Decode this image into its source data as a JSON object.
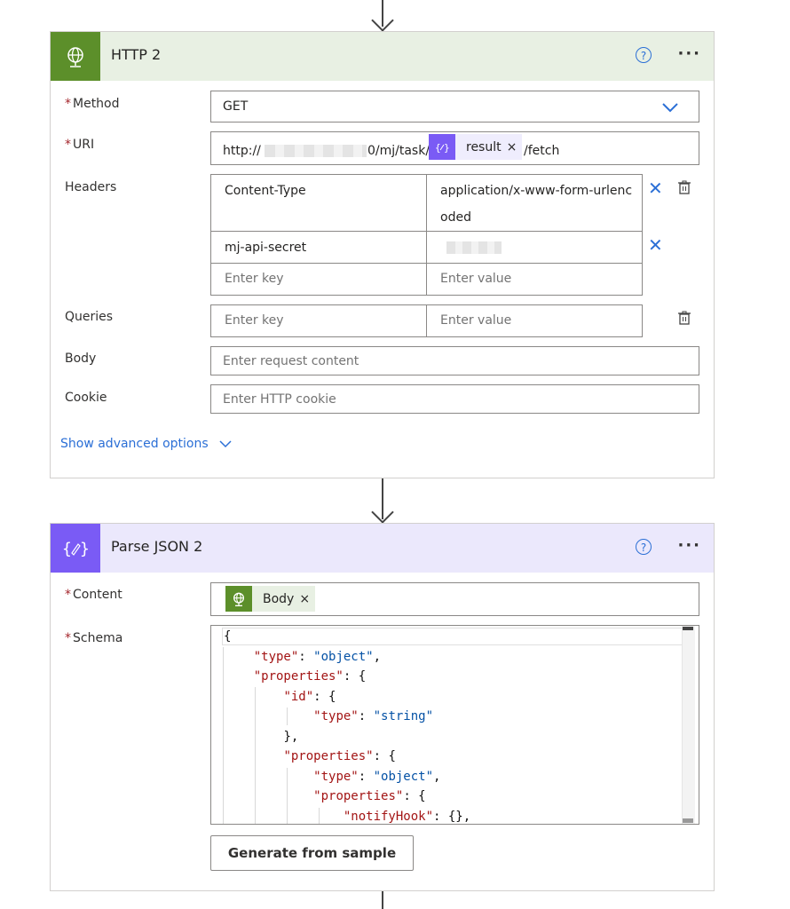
{
  "http_card": {
    "title": "HTTP 2",
    "header_color": "#e8f0e3",
    "icon_color": "#5c8f2a",
    "icon": "globe-icon",
    "method": {
      "label": "Method",
      "value": "GET"
    },
    "uri": {
      "label": "URI",
      "prefix": "http://",
      "suffix": "0/mj/task/",
      "token": "result",
      "after": "/fetch"
    },
    "headers": {
      "label": "Headers",
      "rows": [
        {
          "key": "Content-Type",
          "value_line1": "application/x-www-form-urlenc",
          "value_line2": "oded"
        },
        {
          "key": "mj-api-secret",
          "value_line1": "",
          "value_line2": ""
        }
      ],
      "key_placeholder": "Enter key",
      "value_placeholder": "Enter value"
    },
    "queries": {
      "label": "Queries",
      "key_placeholder": "Enter key",
      "value_placeholder": "Enter value"
    },
    "body": {
      "label": "Body",
      "placeholder": "Enter request content"
    },
    "cookie": {
      "label": "Cookie",
      "placeholder": "Enter HTTP cookie"
    },
    "advanced_label": "Show advanced options"
  },
  "parse_card": {
    "title": "Parse JSON 2",
    "header_color": "#ebe8fc",
    "icon_color": "#7a5bf5",
    "icon": "braces-icon",
    "content": {
      "label": "Content",
      "token": "Body"
    },
    "schema": {
      "label": "Schema"
    },
    "generate_label": "Generate from sample"
  },
  "schema_lines": [
    {
      "indent": "",
      "parts": [
        [
          "p",
          "{"
        ]
      ]
    },
    {
      "indent": "    ",
      "parts": [
        [
          "k",
          "\"type\""
        ],
        [
          "p",
          ": "
        ],
        [
          "s",
          "\"object\""
        ],
        [
          "p",
          ","
        ]
      ]
    },
    {
      "indent": "    ",
      "parts": [
        [
          "k",
          "\"properties\""
        ],
        [
          "p",
          ": {"
        ]
      ]
    },
    {
      "indent": "        ",
      "parts": [
        [
          "k",
          "\"id\""
        ],
        [
          "p",
          ": {"
        ]
      ]
    },
    {
      "indent": "            ",
      "parts": [
        [
          "k",
          "\"type\""
        ],
        [
          "p",
          ": "
        ],
        [
          "s",
          "\"string\""
        ]
      ]
    },
    {
      "indent": "        ",
      "parts": [
        [
          "p",
          "},"
        ]
      ]
    },
    {
      "indent": "        ",
      "parts": [
        [
          "k",
          "\"properties\""
        ],
        [
          "p",
          ": {"
        ]
      ]
    },
    {
      "indent": "            ",
      "parts": [
        [
          "k",
          "\"type\""
        ],
        [
          "p",
          ": "
        ],
        [
          "s",
          "\"object\""
        ],
        [
          "p",
          ","
        ]
      ]
    },
    {
      "indent": "            ",
      "parts": [
        [
          "k",
          "\"properties\""
        ],
        [
          "p",
          ": {"
        ]
      ]
    },
    {
      "indent": "                ",
      "parts": [
        [
          "k",
          "\"notifyHook\""
        ],
        [
          "p",
          ": {},"
        ]
      ]
    }
  ]
}
